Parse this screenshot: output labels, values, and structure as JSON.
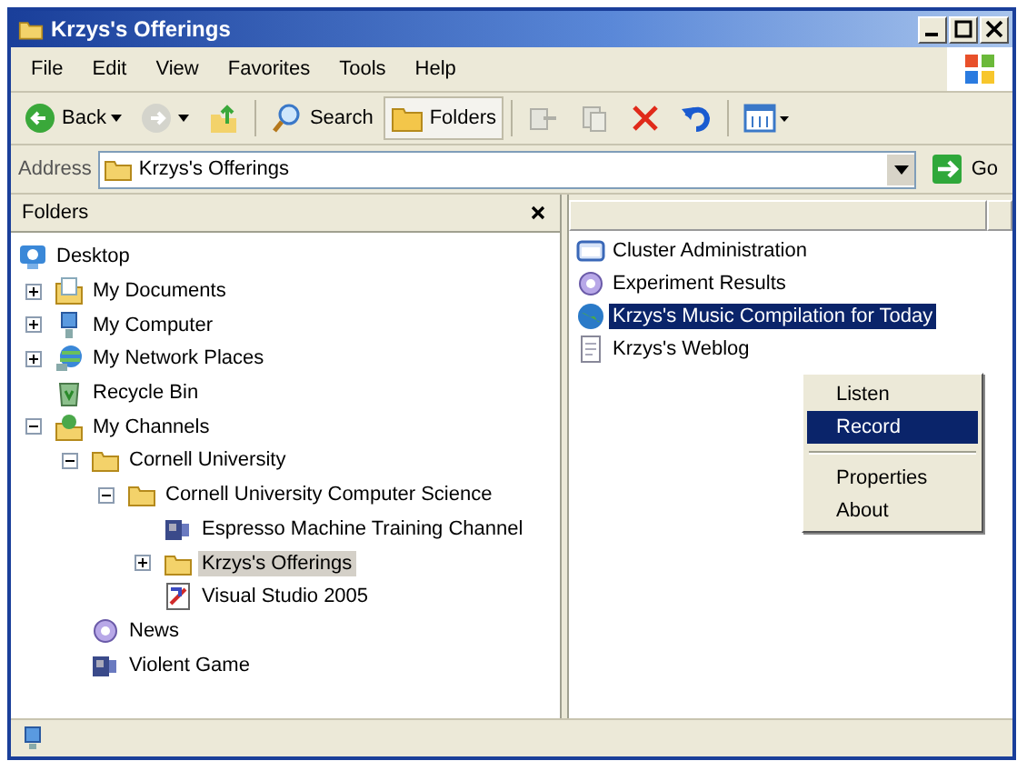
{
  "window": {
    "title": "Krzys's Offerings"
  },
  "menu": [
    "File",
    "Edit",
    "View",
    "Favorites",
    "Tools",
    "Help"
  ],
  "toolbar": [
    {
      "kind": "back",
      "label": "Back"
    },
    {
      "kind": "forward"
    },
    {
      "kind": "up"
    },
    {
      "kind": "search",
      "label": "Search"
    },
    {
      "kind": "folders",
      "label": "Folders",
      "selected": true
    },
    {
      "kind": "move"
    },
    {
      "kind": "copy"
    },
    {
      "kind": "delete"
    },
    {
      "kind": "undo"
    },
    {
      "kind": "views"
    }
  ],
  "address": {
    "label": "Address",
    "value": "Krzys's Offerings",
    "go": "Go"
  },
  "folders_pane": {
    "title": "Folders",
    "tree": [
      {
        "label": "Desktop",
        "kind": "desktop",
        "selected": false,
        "children": [
          {
            "label": "My Documents",
            "kind": "documents",
            "expanded": false,
            "selected": false
          },
          {
            "label": "My Computer",
            "kind": "computer",
            "expanded": false,
            "selected": false
          },
          {
            "label": "My Network Places",
            "kind": "network",
            "expanded": false,
            "selected": false
          },
          {
            "label": "Recycle Bin",
            "kind": "recycle",
            "selected": false
          },
          {
            "label": "My Channels",
            "kind": "channels",
            "expanded": true,
            "selected": false,
            "children": [
              {
                "label": "Cornell University",
                "kind": "folder",
                "expanded": true,
                "selected": false,
                "children": [
                  {
                    "label": "Cornell University Computer Science",
                    "kind": "folder",
                    "expanded": true,
                    "selected": false,
                    "children": [
                      {
                        "label": "Espresso Machine Training Channel",
                        "kind": "channel",
                        "selected": false
                      },
                      {
                        "label": "Krzys's Offerings",
                        "kind": "folder",
                        "expanded": false,
                        "selected": true
                      },
                      {
                        "label": "Visual Studio 2005",
                        "kind": "studio",
                        "selected": false
                      }
                    ]
                  }
                ]
              },
              {
                "label": "News",
                "kind": "news",
                "selected": false
              },
              {
                "label": "Violent Game",
                "kind": "channel",
                "selected": false
              }
            ]
          }
        ]
      }
    ]
  },
  "file_list": {
    "items": [
      {
        "label": "Cluster Administration",
        "kind": "cluster",
        "selected": false
      },
      {
        "label": "Experiment Results",
        "kind": "news",
        "selected": false
      },
      {
        "label": "Krzys's Music Compilation for Today",
        "kind": "web",
        "selected": true
      },
      {
        "label": "Krzys's Weblog",
        "kind": "page",
        "selected": false
      }
    ]
  },
  "context_menu": {
    "groups": [
      [
        {
          "label": "Listen",
          "selected": false
        },
        {
          "label": "Record",
          "selected": true
        }
      ],
      [
        {
          "label": "Properties",
          "selected": false
        },
        {
          "label": "About",
          "selected": false
        }
      ]
    ]
  }
}
